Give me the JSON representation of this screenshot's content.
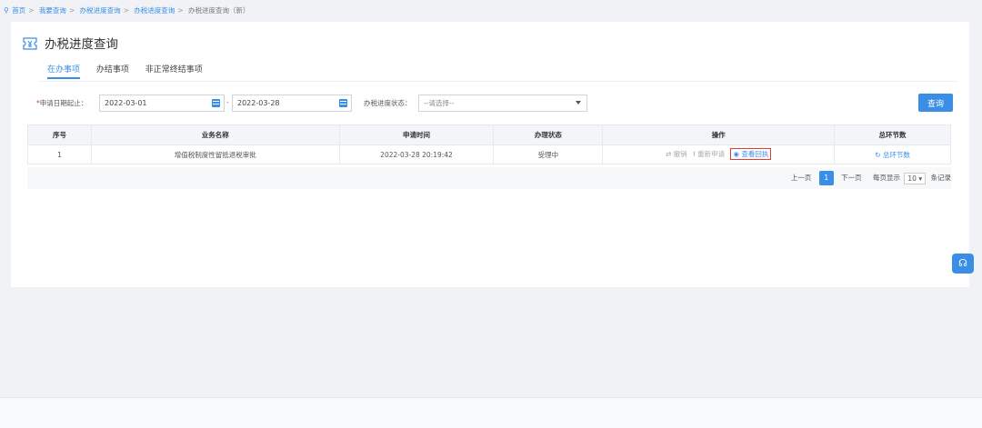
{
  "breadcrumb": {
    "items": [
      "首页",
      "我要查询",
      "办税进度查询",
      "办税进度查询"
    ],
    "current": "办税进度查询（新）"
  },
  "header": {
    "title": "办税进度查询"
  },
  "tabs": [
    {
      "label": "在办事项",
      "active": true
    },
    {
      "label": "办结事项",
      "active": false
    },
    {
      "label": "非正常终结事项",
      "active": false
    }
  ],
  "filters": {
    "date_label": "申请日期起止：",
    "required_mark": "*",
    "start_date": "2022-03-01",
    "end_date": "2022-03-28",
    "range_sep": "-",
    "status_label": "办税进度状态：",
    "status_value": "--请选择--",
    "query_label": "查询"
  },
  "table": {
    "columns": [
      "序号",
      "业务名称",
      "申请时间",
      "办理状态",
      "操作",
      "总环节数"
    ],
    "rows": [
      {
        "index": "1",
        "name": "增值税制度性留抵退税审批",
        "time": "2022-03-28 20:19:42",
        "status": "受理中",
        "ops": {
          "revoke": "撤销",
          "resubmit": "重新申请",
          "view_receipt": "查看回执"
        },
        "steps": "总环节数"
      }
    ]
  },
  "pager": {
    "prev": "上一页",
    "current": "1",
    "next": "下一页",
    "per_page_label": "每页显示",
    "per_page_value": "10",
    "records_label": "条记录"
  },
  "colors": {
    "accent": "#3a8ee6",
    "highlight": "#e53935",
    "required": "#e03b3b"
  }
}
